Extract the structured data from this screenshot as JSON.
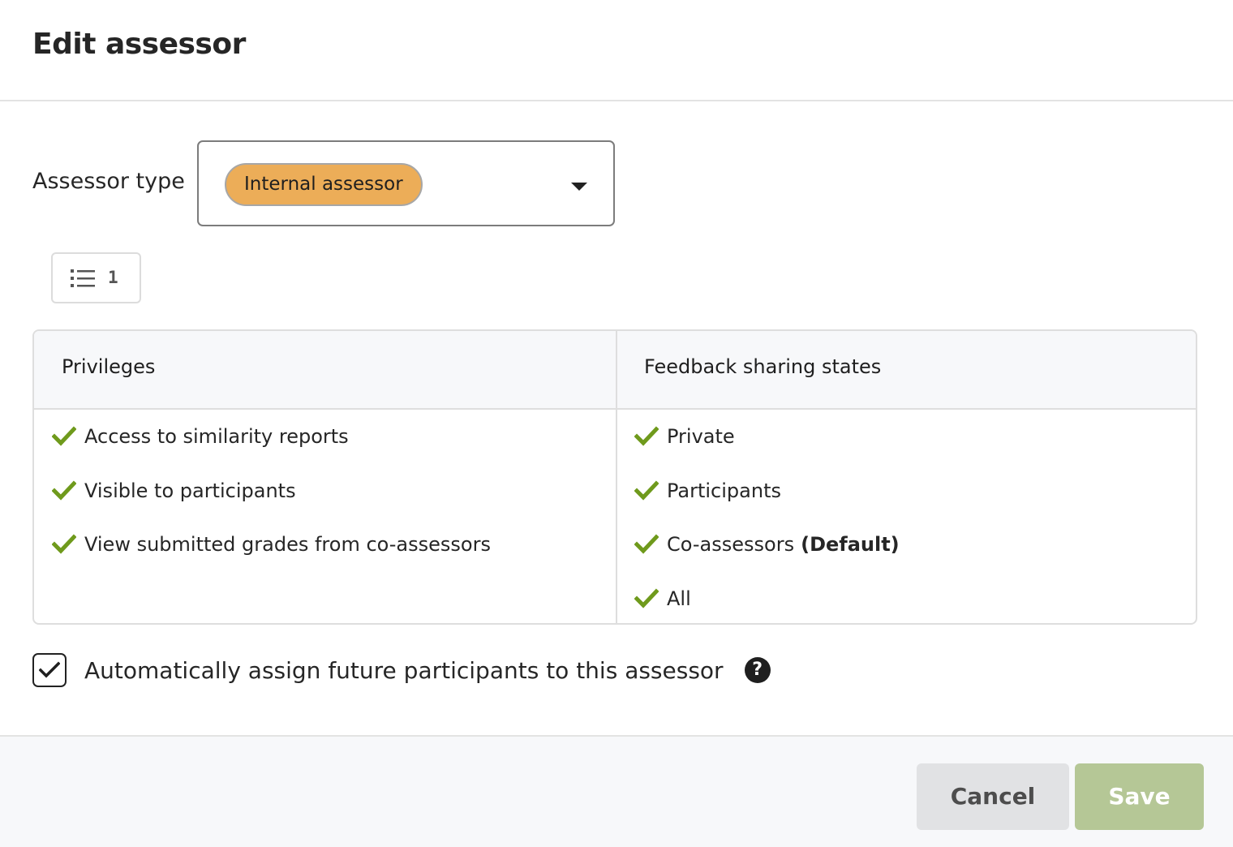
{
  "dialog": {
    "title": "Edit assessor"
  },
  "assessor_type": {
    "label": "Assessor type",
    "selected": "Internal assessor",
    "pill_color": "#ecad58"
  },
  "list_toggle": {
    "icon": "list-icon",
    "count": "1"
  },
  "table": {
    "headers": {
      "privileges": "Privileges",
      "sharing": "Feedback sharing states"
    },
    "privileges": [
      "Access to similarity reports",
      "Visible to participants",
      "View submitted grades from co-assessors"
    ],
    "sharing_states": [
      {
        "label": "Private",
        "suffix": ""
      },
      {
        "label": "Participants",
        "suffix": ""
      },
      {
        "label": "Co-assessors",
        "suffix": "(Default)"
      },
      {
        "label": "All",
        "suffix": ""
      }
    ],
    "check_color": "#6f9a1c"
  },
  "auto_assign": {
    "checked": true,
    "label": "Automatically assign future participants to this assessor",
    "help_icon": "question-circle-icon"
  },
  "footer": {
    "cancel_label": "Cancel",
    "save_label": "Save",
    "save_color": "#b5c796"
  }
}
